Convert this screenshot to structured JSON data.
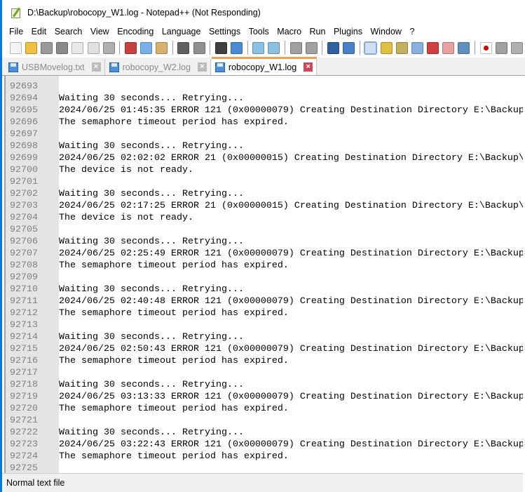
{
  "window": {
    "title": "D:\\Backup\\robocopy_W1.log - Notepad++ (Not Responding)"
  },
  "menu": [
    "File",
    "Edit",
    "Search",
    "View",
    "Encoding",
    "Language",
    "Settings",
    "Tools",
    "Macro",
    "Run",
    "Plugins",
    "Window",
    "?"
  ],
  "toolbar": [
    "new-file",
    "open",
    "save",
    "save-all",
    "close",
    "close-all",
    "print",
    "cut",
    "copy",
    "paste",
    "undo",
    "redo",
    "find",
    "replace",
    "zoom-in",
    "zoom-out",
    "sync-vertical",
    "sync-horizontal",
    "word-wrap",
    "show-all-chars",
    "indent-guide",
    "udl",
    "doc-map",
    "doc-list",
    "function-list",
    "folder-workspace",
    "monitor",
    "record-macro",
    "stop-macro",
    "play-macro"
  ],
  "tabs": [
    {
      "label": "USBMovelog.txt",
      "active": false
    },
    {
      "label": "robocopy_W2.log",
      "active": false
    },
    {
      "label": "robocopy_W1.log",
      "active": true
    }
  ],
  "lines": [
    {
      "n": "92693",
      "t": ""
    },
    {
      "n": "92694",
      "t": "Waiting 30 seconds... Retrying..."
    },
    {
      "n": "92695",
      "t": "2024/06/25 01:45:35 ERROR 121 (0x00000079) Creating Destination Directory E:\\Backup"
    },
    {
      "n": "92696",
      "t": "The semaphore timeout period has expired."
    },
    {
      "n": "92697",
      "t": ""
    },
    {
      "n": "92698",
      "t": "Waiting 30 seconds... Retrying..."
    },
    {
      "n": "92699",
      "t": "2024/06/25 02:02:02 ERROR 21 (0x00000015) Creating Destination Directory E:\\Backup\\"
    },
    {
      "n": "92700",
      "t": "The device is not ready."
    },
    {
      "n": "92701",
      "t": ""
    },
    {
      "n": "92702",
      "t": "Waiting 30 seconds... Retrying..."
    },
    {
      "n": "92703",
      "t": "2024/06/25 02:17:25 ERROR 21 (0x00000015) Creating Destination Directory E:\\Backup\\"
    },
    {
      "n": "92704",
      "t": "The device is not ready."
    },
    {
      "n": "92705",
      "t": ""
    },
    {
      "n": "92706",
      "t": "Waiting 30 seconds... Retrying..."
    },
    {
      "n": "92707",
      "t": "2024/06/25 02:25:49 ERROR 121 (0x00000079) Creating Destination Directory E:\\Backup"
    },
    {
      "n": "92708",
      "t": "The semaphore timeout period has expired."
    },
    {
      "n": "92709",
      "t": ""
    },
    {
      "n": "92710",
      "t": "Waiting 30 seconds... Retrying..."
    },
    {
      "n": "92711",
      "t": "2024/06/25 02:40:48 ERROR 121 (0x00000079) Creating Destination Directory E:\\Backup"
    },
    {
      "n": "92712",
      "t": "The semaphore timeout period has expired."
    },
    {
      "n": "92713",
      "t": ""
    },
    {
      "n": "92714",
      "t": "Waiting 30 seconds... Retrying..."
    },
    {
      "n": "92715",
      "t": "2024/06/25 02:50:43 ERROR 121 (0x00000079) Creating Destination Directory E:\\Backup"
    },
    {
      "n": "92716",
      "t": "The semaphore timeout period has expired."
    },
    {
      "n": "92717",
      "t": ""
    },
    {
      "n": "92718",
      "t": "Waiting 30 seconds... Retrying..."
    },
    {
      "n": "92719",
      "t": "2024/06/25 03:13:33 ERROR 121 (0x00000079) Creating Destination Directory E:\\Backup"
    },
    {
      "n": "92720",
      "t": "The semaphore timeout period has expired."
    },
    {
      "n": "92721",
      "t": ""
    },
    {
      "n": "92722",
      "t": "Waiting 30 seconds... Retrying..."
    },
    {
      "n": "92723",
      "t": "2024/06/25 03:22:43 ERROR 121 (0x00000079) Creating Destination Directory E:\\Backup"
    },
    {
      "n": "92724",
      "t": "The semaphore timeout period has expired."
    },
    {
      "n": "92725",
      "t": ""
    }
  ],
  "status": {
    "file_type": "Normal text file"
  }
}
